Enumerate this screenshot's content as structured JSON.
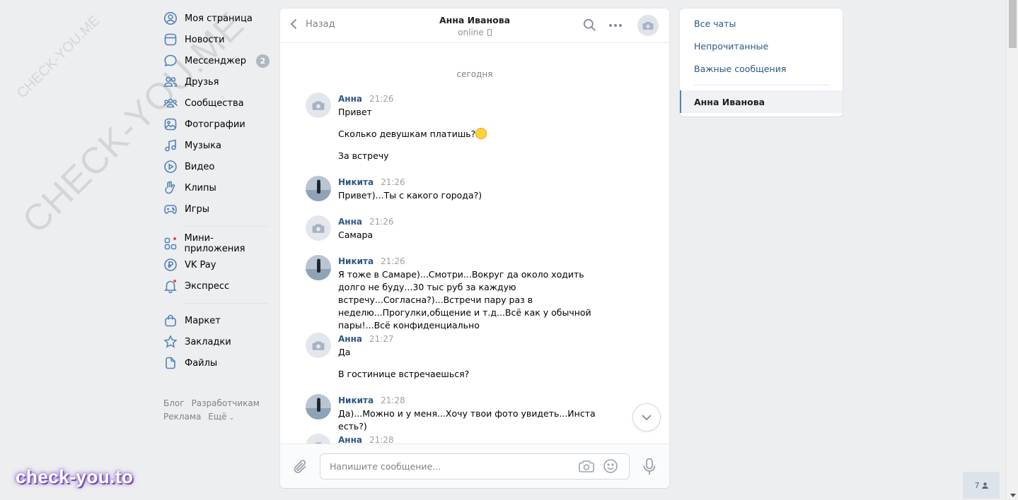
{
  "watermark": {
    "big": "CHECK-YOU.ME",
    "small": "CHECK-YOU.ME",
    "brand": "check-you.to"
  },
  "nav": {
    "items": [
      {
        "label": "Моя страница"
      },
      {
        "label": "Новости"
      },
      {
        "label": "Мессенджер",
        "badge": "2"
      },
      {
        "label": "Друзья"
      },
      {
        "label": "Сообщества"
      },
      {
        "label": "Фотографии"
      },
      {
        "label": "Музыка"
      },
      {
        "label": "Видео"
      },
      {
        "label": "Клипы"
      },
      {
        "label": "Игры"
      }
    ],
    "apps": [
      {
        "label": "Мини-приложения"
      },
      {
        "label": "VK Pay"
      },
      {
        "label": "Экспресс"
      }
    ],
    "more": [
      {
        "label": "Маркет"
      },
      {
        "label": "Закладки"
      },
      {
        "label": "Файлы"
      }
    ],
    "footer": {
      "blog": "Блог",
      "dev": "Разработчикам",
      "ads": "Реклама",
      "more": "Ещё"
    }
  },
  "chat": {
    "back_label": "Назад",
    "peer_name": "Анна Иванова",
    "peer_status": "online",
    "day_label": "сегодня",
    "messages": [
      {
        "author": "Анна",
        "time": "21:26",
        "lines": [
          "Привет",
          "Сколько девушкам платишь?",
          "За встречу"
        ]
      },
      {
        "author": "Никита",
        "time": "21:26",
        "lines": [
          "Привет)...Ты с какого города?)"
        ]
      },
      {
        "author": "Анна",
        "time": "21:26",
        "lines": [
          "Самара"
        ]
      },
      {
        "author": "Никита",
        "time": "21:26",
        "lines": [
          "Я тоже в Самаре)...Смотри...Вокруг да около ходить долго не буду...30 тыс руб за каждую встречу...Согласна?)...Встречи пару раз в неделю...Прогулки,общение и т.д...Всё как у обычной пары!...Всё конфиденциально"
        ]
      },
      {
        "author": "Анна",
        "time": "21:27",
        "lines": [
          "Да",
          "В гостинице встречаешься?"
        ]
      },
      {
        "author": "Никита",
        "time": "21:28",
        "lines": [
          "Да)...Можно и у меня...Хочу твои фото увидеть...Инста есть?)"
        ]
      },
      {
        "author": "Анна",
        "time": "21:28",
        "lines": []
      }
    ],
    "composer_placeholder": "Напишите сообщение..."
  },
  "folders": {
    "items": [
      {
        "label": "Все чаты"
      },
      {
        "label": "Непрочитанные"
      },
      {
        "label": "Важные сообщения"
      }
    ],
    "active": "Анна Иванова"
  },
  "online_count": "7",
  "colors": {
    "link": "#2a5885",
    "accent": "#5181b8",
    "bg": "#edeef0"
  }
}
